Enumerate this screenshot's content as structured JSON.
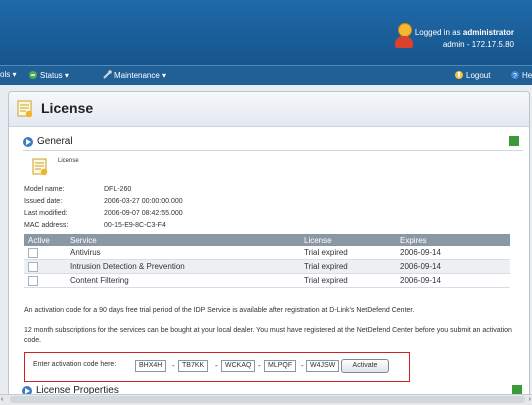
{
  "header": {
    "logged_in_prefix": "Logged in as",
    "user": "administrator",
    "user_ip": "admin - 172.17.5.80"
  },
  "menu": {
    "tools_partial": "ols",
    "status": "Status",
    "maintenance": "Maintenance",
    "logout": "Logout",
    "help_partial": "He"
  },
  "page": {
    "title": "License",
    "general_section": "General",
    "license_label": "License",
    "properties_section": "License Properties"
  },
  "info": {
    "model_name_label": "Model name:",
    "model_name": "DFL-260",
    "issued_date_label": "Issued date:",
    "issued_date": "2006-03-27 00:00:00.000",
    "last_modified_label": "Last modified:",
    "last_modified": "2006-09-07 08:42:55.000",
    "mac_label": "MAC address:",
    "mac": "00-15-E9-8C-C3-F4"
  },
  "table": {
    "headers": [
      "Active",
      "Service",
      "License",
      "Expires"
    ],
    "rows": [
      {
        "service": "Antivirus",
        "license": "Trial expired",
        "expires": "2006-09-14"
      },
      {
        "service": "Intrusion Detection & Prevention",
        "license": "Trial expired",
        "expires": "2006-09-14"
      },
      {
        "service": "Content Filtering",
        "license": "Trial expired",
        "expires": "2006-09-14"
      }
    ]
  },
  "notes": {
    "note1": "An activation code for a 90 days free trial period of the IDP Service is available after registration at D-Link's NetDefend Center.",
    "note2": "12 month subscriptions for the services can be bought at your local dealer. You must have registered at the NetDefend Center before you submit an activation code."
  },
  "activation": {
    "label": "Enter activation code here:",
    "codes": [
      "BHX4H",
      "TB7KK",
      "WCKAQ",
      "MLPQF",
      "W4JSW"
    ],
    "button": "Activate"
  },
  "colors": {
    "header_bg": "#1f6aa8",
    "menu_bg": "#215f97",
    "activation_border": "#cc2222"
  }
}
